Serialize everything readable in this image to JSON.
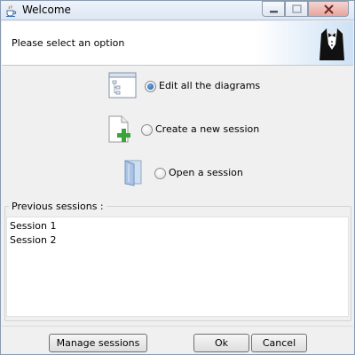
{
  "window": {
    "title": "Welcome",
    "accent": "#3b6db0"
  },
  "header": {
    "prompt": "Please select an option",
    "logo_icon": "tuxedo-icon"
  },
  "options": [
    {
      "label": "Edit all the diagrams",
      "icon": "diagram-list-icon",
      "selected": true
    },
    {
      "label": "Create a new session",
      "icon": "new-document-plus-icon",
      "selected": false
    },
    {
      "label": "Open a session",
      "icon": "open-folder-icon",
      "selected": false
    }
  ],
  "previous_sessions": {
    "title": "Previous sessions :",
    "items": [
      "Session 1",
      "Session 2"
    ]
  },
  "buttons": {
    "manage": "Manage sessions",
    "ok": "Ok",
    "cancel": "Cancel"
  }
}
